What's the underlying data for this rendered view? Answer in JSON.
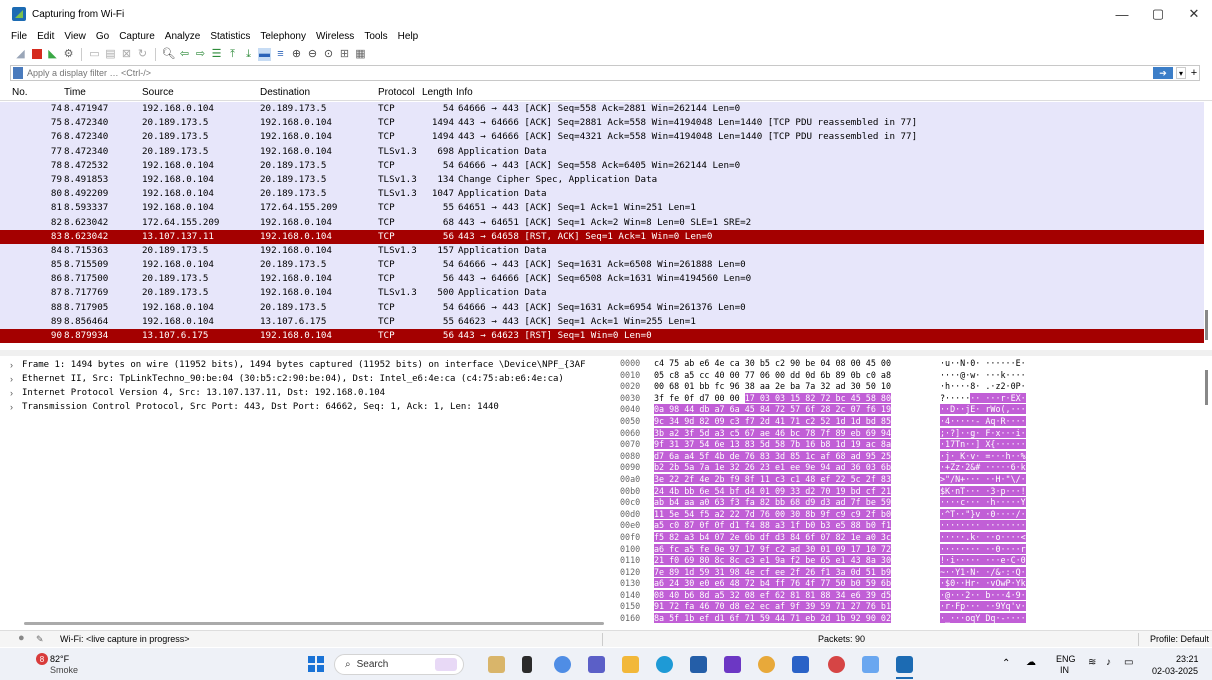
{
  "window": {
    "title": "Capturing from Wi-Fi",
    "controls": [
      "—",
      "▢",
      "✕"
    ]
  },
  "menu": [
    "File",
    "Edit",
    "View",
    "Go",
    "Capture",
    "Analyze",
    "Statistics",
    "Telephony",
    "Wireless",
    "Tools",
    "Help"
  ],
  "filter": {
    "placeholder": "Apply a display filter … <Ctrl-/>"
  },
  "columns": {
    "no": "No.",
    "time": "Time",
    "source": "Source",
    "destination": "Destination",
    "protocol": "Protocol",
    "length": "Length",
    "info": "Info"
  },
  "packets": [
    {
      "no": "74",
      "time": "8.471947",
      "src": "192.168.0.104",
      "dst": "20.189.173.5",
      "proto": "TCP",
      "len": "54",
      "info": "64666 → 443 [ACK] Seq=558 Ack=2881 Win=262144 Len=0"
    },
    {
      "no": "75",
      "time": "8.472340",
      "src": "20.189.173.5",
      "dst": "192.168.0.104",
      "proto": "TCP",
      "len": "1494",
      "info": "443 → 64666 [ACK] Seq=2881 Ack=558 Win=4194048 Len=1440 [TCP PDU reassembled in 77]"
    },
    {
      "no": "76",
      "time": "8.472340",
      "src": "20.189.173.5",
      "dst": "192.168.0.104",
      "proto": "TCP",
      "len": "1494",
      "info": "443 → 64666 [ACK] Seq=4321 Ack=558 Win=4194048 Len=1440 [TCP PDU reassembled in 77]"
    },
    {
      "no": "77",
      "time": "8.472340",
      "src": "20.189.173.5",
      "dst": "192.168.0.104",
      "proto": "TLSv1.3",
      "len": "698",
      "info": "Application Data"
    },
    {
      "no": "78",
      "time": "8.472532",
      "src": "192.168.0.104",
      "dst": "20.189.173.5",
      "proto": "TCP",
      "len": "54",
      "info": "64666 → 443 [ACK] Seq=558 Ack=6405 Win=262144 Len=0"
    },
    {
      "no": "79",
      "time": "8.491853",
      "src": "192.168.0.104",
      "dst": "20.189.173.5",
      "proto": "TLSv1.3",
      "len": "134",
      "info": "Change Cipher Spec, Application Data"
    },
    {
      "no": "80",
      "time": "8.492209",
      "src": "192.168.0.104",
      "dst": "20.189.173.5",
      "proto": "TLSv1.3",
      "len": "1047",
      "info": "Application Data"
    },
    {
      "no": "81",
      "time": "8.593337",
      "src": "192.168.0.104",
      "dst": "172.64.155.209",
      "proto": "TCP",
      "len": "55",
      "info": "64651 → 443 [ACK] Seq=1 Ack=1 Win=251 Len=1"
    },
    {
      "no": "82",
      "time": "8.623042",
      "src": "172.64.155.209",
      "dst": "192.168.0.104",
      "proto": "TCP",
      "len": "68",
      "info": "443 → 64651 [ACK] Seq=1 Ack=2 Win=8 Len=0 SLE=1 SRE=2"
    },
    {
      "no": "83",
      "time": "8.623042",
      "src": "13.107.137.11",
      "dst": "192.168.0.104",
      "proto": "TCP",
      "len": "56",
      "info": "443 → 64658 [RST, ACK] Seq=1 Ack=1 Win=0 Len=0",
      "rst": true
    },
    {
      "no": "84",
      "time": "8.715363",
      "src": "20.189.173.5",
      "dst": "192.168.0.104",
      "proto": "TLSv1.3",
      "len": "157",
      "info": "Application Data"
    },
    {
      "no": "85",
      "time": "8.715509",
      "src": "192.168.0.104",
      "dst": "20.189.173.5",
      "proto": "TCP",
      "len": "54",
      "info": "64666 → 443 [ACK] Seq=1631 Ack=6508 Win=261888 Len=0"
    },
    {
      "no": "86",
      "time": "8.717500",
      "src": "20.189.173.5",
      "dst": "192.168.0.104",
      "proto": "TCP",
      "len": "56",
      "info": "443 → 64666 [ACK] Seq=6508 Ack=1631 Win=4194560 Len=0"
    },
    {
      "no": "87",
      "time": "8.717769",
      "src": "20.189.173.5",
      "dst": "192.168.0.104",
      "proto": "TLSv1.3",
      "len": "500",
      "info": "Application Data"
    },
    {
      "no": "88",
      "time": "8.717905",
      "src": "192.168.0.104",
      "dst": "20.189.173.5",
      "proto": "TCP",
      "len": "54",
      "info": "64666 → 443 [ACK] Seq=1631 Ack=6954 Win=261376 Len=0"
    },
    {
      "no": "89",
      "time": "8.856464",
      "src": "192.168.0.104",
      "dst": "13.107.6.175",
      "proto": "TCP",
      "len": "55",
      "info": "64623 → 443 [ACK] Seq=1 Ack=1 Win=255 Len=1"
    },
    {
      "no": "90",
      "time": "8.879934",
      "src": "13.107.6.175",
      "dst": "192.168.0.104",
      "proto": "TCP",
      "len": "56",
      "info": "443 → 64623 [RST] Seq=1 Win=0 Len=0",
      "rst": true
    }
  ],
  "details": [
    "Frame 1: 1494 bytes on wire (11952 bits), 1494 bytes captured (11952 bits) on interface \\Device\\NPF_{3AF",
    "Ethernet II, Src: TpLinkTechno_90:be:04 (30:b5:c2:90:be:04), Dst: Intel_e6:4e:ca (c4:75:ab:e6:4e:ca)",
    "Internet Protocol Version 4, Src: 13.107.137.11, Dst: 192.168.0.104",
    "Transmission Control Protocol, Src Port: 443, Dst Port: 64662, Seq: 1, Ack: 1, Len: 1440"
  ],
  "bytes": [
    {
      "off": "0000",
      "hex": "c4 75 ab e6 4e ca 30 b5  c2 90 be 04 08 00 45 00",
      "ascii": "·u··N·0· ······E·",
      "hl": 0
    },
    {
      "off": "0010",
      "hex": "05 c8 a5 cc 40 00 77 06  00 dd 0d 6b 89 0b c0 a8",
      "ascii": "····@·w· ···k····",
      "hl": 0
    },
    {
      "off": "0020",
      "hex": "00 68 01 bb fc 96 38 aa  2e ba 7a 32 ad 30 50 10",
      "ascii": "·h····8· .·z2·0P·",
      "hl": 0
    },
    {
      "off": "0030",
      "hex": "3f fe 0f d7 00 00 17 03  03 15 82 72 bc 45 58 80",
      "ascii": "?······· ···r·EX·",
      "hl": 1
    },
    {
      "off": "0040",
      "hex": "0a 98 44 db a7 6a 45 84  72 57 6f 28 2c 07 f6 19",
      "ascii": "··D··jE· rWo(,···",
      "hl": 2
    },
    {
      "off": "0050",
      "hex": "9c 34 9d 82 09 c3 f7 2d  41 71 c2 52 1d 1d bd 85",
      "ascii": "·4·····- Aq·R····",
      "hl": 2
    },
    {
      "off": "0060",
      "hex": "3b a2 3f 5d a3 c5 67 ae  46 bc 78 7f 89 eb 69 94",
      "ascii": ";·?]··g· F·x···i·",
      "hl": 2
    },
    {
      "off": "0070",
      "hex": "9f 31 37 54 6e 13 83 5d  58 7b 16 b8 1d 19 ac 8a",
      "ascii": "·17Tn··] X{······",
      "hl": 2
    },
    {
      "off": "0080",
      "hex": "d7 6a a4 5f 4b de 76 83  3d 85 1c af 68 ad 95 25",
      "ascii": "·j·_K·v· =···h··%",
      "hl": 2
    },
    {
      "off": "0090",
      "hex": "b2 2b 5a 7a 1e 32 26 23  e1 ee 9e 94 ad 36 03 6b",
      "ascii": "·+Zz·2&# ·····6·k",
      "hl": 2
    },
    {
      "off": "00a0",
      "hex": "3e 22 2f 4e 2b f9 8f 11  c3 c1 48 ef 22 5c 2f 83",
      "ascii": ">\"/N+··· ··H·\"\\/·",
      "hl": 2
    },
    {
      "off": "00b0",
      "hex": "24 4b bb 6e 54 bf d4 01  09 33 d2 70 19 bd cf 21",
      "ascii": "$K·nT··· ·3·p···!",
      "hl": 2
    },
    {
      "off": "00c0",
      "hex": "ab b4 aa a0 63 f3 fa 82  bb 68 d9 d3 ad 7f be 59",
      "ascii": "····c··· ·h·····Y",
      "hl": 2
    },
    {
      "off": "00d0",
      "hex": "11 5e 54 f5 a2 22 7d 76  00 30 8b 9f c9 c9 2f b0",
      "ascii": "·^T··\"}v ·0····/·",
      "hl": 2
    },
    {
      "off": "00e0",
      "hex": "a5 c0 87 0f 0f d1 f4 88  a3 1f b0 b3 e5 88 b0 f1",
      "ascii": "········ ········",
      "hl": 2
    },
    {
      "off": "00f0",
      "hex": "f5 82 a3 b4 07 2e 6b df  d3 84 6f 07 82 1e a0 3c",
      "ascii": "·····.k· ··o····<",
      "hl": 2
    },
    {
      "off": "0100",
      "hex": "a6 fc a5 fe 0e 97 17 9f  c2 ad 30 01 09 17 10 72",
      "ascii": "········ ··0····r",
      "hl": 2
    },
    {
      "off": "0110",
      "hex": "21 f0 69 80 8c 8c c3 e1  9a f2 be 65 e1 43 8a 30",
      "ascii": "!·i····· ···e·C·0",
      "hl": 2
    },
    {
      "off": "0120",
      "hex": "7e 89 1d 59 31 98 4e cf  ee 2f 26 f1 3a 0d 51 b9",
      "ascii": "~··Y1·N· ·/&·:·Q·",
      "hl": 2
    },
    {
      "off": "0130",
      "hex": "a6 24 30 e0 e6 48 72 b4  ff 76 4f 77 50 b0 59 6b",
      "ascii": "·$0··Hr· ·vOwP·Yk",
      "hl": 2
    },
    {
      "off": "0140",
      "hex": "08 40 b6 8d a5 32 08 ef  62 81 81 88 34 e6 39 d5",
      "ascii": "·@···2·· b···4·9·",
      "hl": 2
    },
    {
      "off": "0150",
      "hex": "91 72 fa 46 70 d8 e2 ec  af 9f 39 59 71 27 76 b1",
      "ascii": "·r·Fp··· ··9Yq'v·",
      "hl": 2
    },
    {
      "off": "0160",
      "hex": "8a 5f 1b ef d1 6f 71 59  44 71 eb 2d 1b 92 90 02",
      "ascii": "·_···oqY Dq·-····",
      "hl": 2
    }
  ],
  "status": {
    "interface": "Wi-Fi: <live capture in progress>",
    "packets": "Packets: 90",
    "profile": "Profile: Default"
  },
  "taskbar": {
    "weather_badge": "8",
    "temperature": "82°F",
    "condition": "Smoke",
    "search": "Search",
    "lang_top": "ENG",
    "lang_bottom": "IN",
    "time": "23:21",
    "date": "02-03-2025"
  },
  "colors": {
    "row_bg": "#e7e6fa",
    "rst_row": "#a40000",
    "byte_highlight": "#c15fd6"
  }
}
